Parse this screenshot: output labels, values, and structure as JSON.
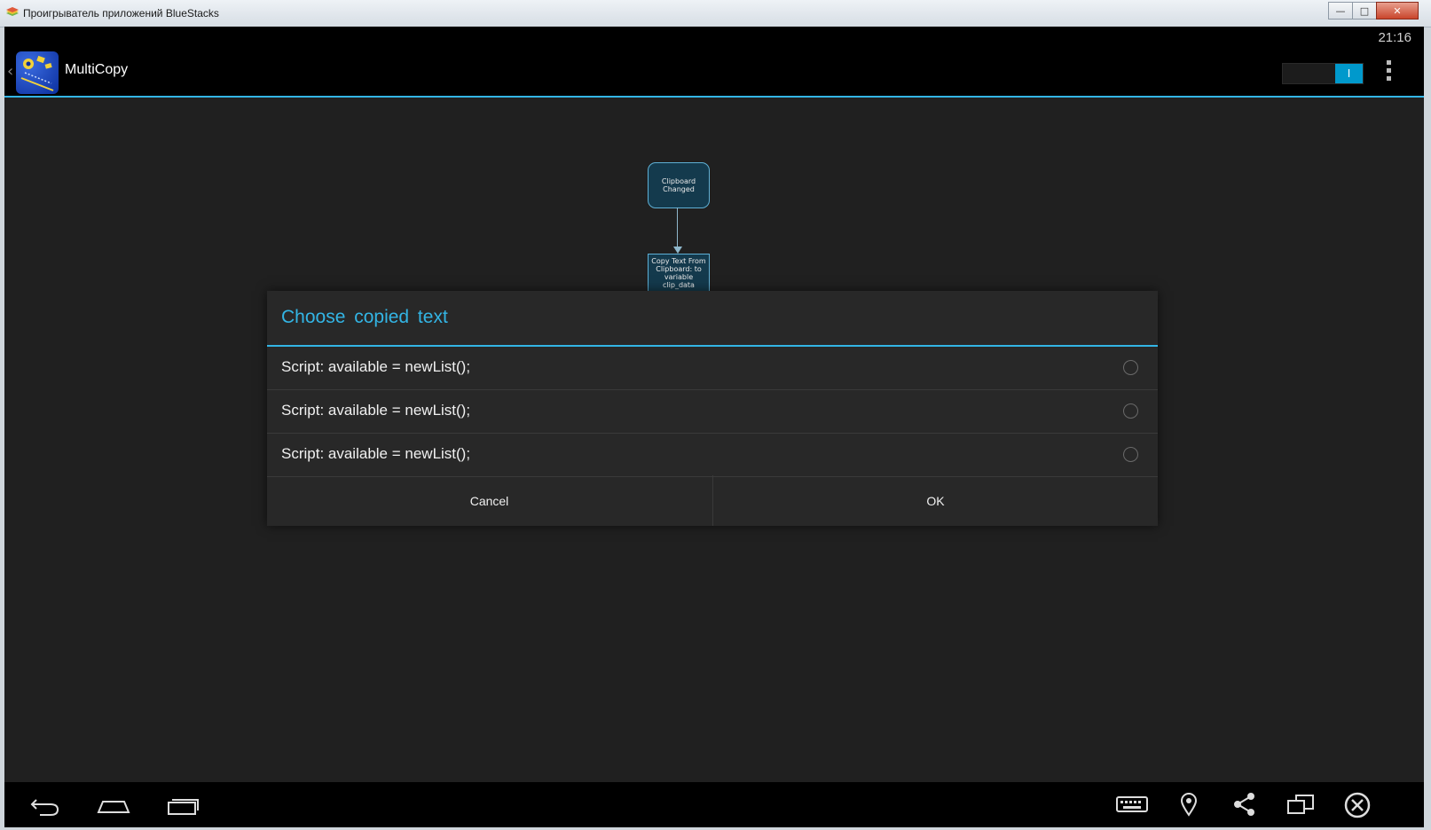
{
  "window": {
    "title": "Проигрыватель приложений BlueStacks",
    "minimize_glyph": "—",
    "maximize_glyph": "□",
    "close_glyph": "✕"
  },
  "statusbar": {
    "time": "21:16"
  },
  "actionbar": {
    "app_title": "MultiCopy",
    "up_caret": "‹",
    "toggle_label": "I"
  },
  "flow": {
    "node1": "Clipboard Changed",
    "node2": "Copy Text From Clipboard: to variable clip_data"
  },
  "dialog": {
    "title": "Choose copied text",
    "items": [
      {
        "label": "Script: available = newList();"
      },
      {
        "label": "Script: available = newList();"
      },
      {
        "label": "Script: available = newList();"
      }
    ],
    "cancel_label": "Cancel",
    "ok_label": "OK"
  },
  "icons": {
    "nav_back": "back-icon",
    "nav_home": "home-icon",
    "nav_recents": "recent-apps-icon",
    "keyboard": "keyboard-icon",
    "location": "location-pin-icon",
    "share": "share-icon",
    "screen": "screen-rotate-icon",
    "close": "close-circle-icon"
  },
  "colors": {
    "accent": "#33b5e5",
    "toggle": "#0099cc"
  }
}
